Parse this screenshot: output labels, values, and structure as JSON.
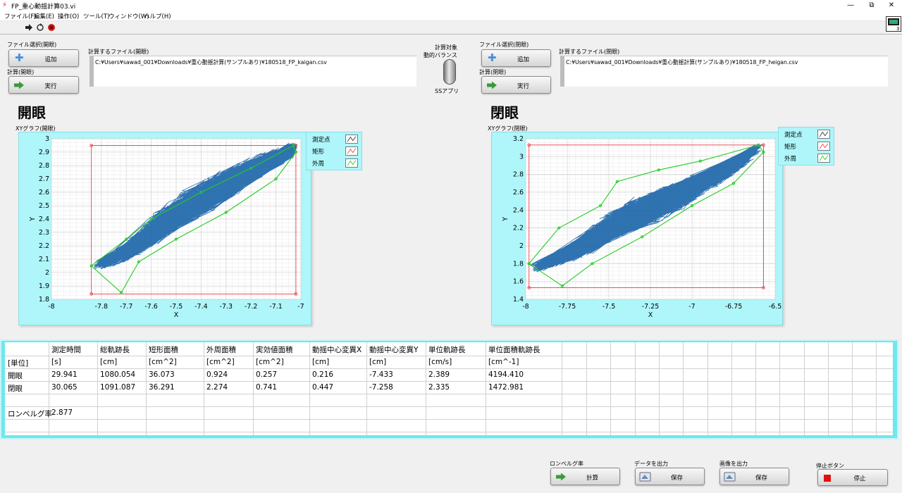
{
  "window": {
    "title": "FP_重心動揺計算03.vi",
    "controls": [
      "—",
      "⧉",
      "✕"
    ]
  },
  "menu": [
    "ファイル(F)",
    "編集(E)",
    "操作(O)",
    "ツール(T)",
    "ウィンドウ(W)",
    "ヘルプ(H)"
  ],
  "left_panel": {
    "file_select_label": "ファイル選択(開眼)",
    "add_button": "追加",
    "calc_label": "計算(開眼)",
    "run_button": "実行",
    "file_list_label": "計算するファイル(開眼)",
    "file_path": "C:¥Users¥sawad_001¥Downloads¥重心動揺計算(サンプルあり)¥180518_FP_kaigan.csv",
    "big_title": "開眼",
    "graph_label": "XYグラフ(開眼)"
  },
  "right_panel": {
    "file_select_label": "ファイル選択(閉眼)",
    "add_button": "追加",
    "calc_label": "計算(閉眼)",
    "run_button": "実行",
    "file_list_label": "計算するファイル(閉眼)",
    "file_path": "C:¥Users¥sawad_001¥Downloads¥重心動揺計算(サンプルあり)¥180518_FP_heigan.csv",
    "big_title": "閉眼",
    "graph_label": "XYグラフ(閉眼)"
  },
  "toggle": {
    "label_top": "計算対象",
    "label_top2": "動的バランス",
    "label_bottom": "SSアプリ"
  },
  "legend": [
    "測定点",
    "矩形",
    "外周"
  ],
  "colors": {
    "trace": "#1a64a8",
    "rect": "#e8404a",
    "hull": "#22cc22",
    "graph_bg": "#aef6fa",
    "table_frame": "#6fe7ee"
  },
  "chart_data": [
    {
      "type": "scatter",
      "title": "XYグラフ(開眼)",
      "xlabel": "X",
      "ylabel": "Y",
      "xlim": [
        -8,
        -7
      ],
      "ylim": [
        1.8,
        3
      ],
      "x_ticks": [
        "-8",
        "-7.8",
        "-7.7",
        "-7.6",
        "-7.5",
        "-7.4",
        "-7.3",
        "-7.2",
        "-7.1",
        "-7"
      ],
      "x_tick_values": [
        -8,
        -7.8,
        -7.7,
        -7.6,
        -7.5,
        -7.4,
        -7.3,
        -7.2,
        -7.1,
        -7
      ],
      "y_ticks": [
        "1.8",
        "1.9",
        "2",
        "2.1",
        "2.2",
        "2.3",
        "2.4",
        "2.5",
        "2.6",
        "2.7",
        "2.8",
        "2.9",
        "3"
      ],
      "y_tick_values": [
        1.8,
        1.9,
        2,
        2.1,
        2.2,
        2.3,
        2.4,
        2.5,
        2.6,
        2.7,
        2.8,
        2.9,
        3
      ],
      "rect": {
        "x": [
          -7.84,
          -7.02
        ],
        "y": [
          1.84,
          2.95
        ]
      },
      "series": [
        {
          "name": "測定点",
          "x": [
            -7.82,
            -7.72,
            -7.62,
            -7.55,
            -7.45,
            -7.35,
            -7.25,
            -7.15,
            -7.05,
            -7.03
          ],
          "y": [
            2.05,
            2.12,
            2.25,
            2.38,
            2.5,
            2.6,
            2.72,
            2.82,
            2.9,
            2.94
          ]
        },
        {
          "name": "外周",
          "x": [
            -7.84,
            -7.7,
            -7.6,
            -7.4,
            -7.2,
            -7.03,
            -7.02,
            -7.1,
            -7.3,
            -7.5,
            -7.65,
            -7.72,
            -7.84
          ],
          "y": [
            2.05,
            2.25,
            2.4,
            2.6,
            2.78,
            2.95,
            2.9,
            2.7,
            2.45,
            2.25,
            2.08,
            1.85,
            2.05
          ]
        }
      ]
    },
    {
      "type": "scatter",
      "title": "XYグラフ(閉眼)",
      "xlabel": "X",
      "ylabel": "Y",
      "xlim": [
        -8,
        -6.5
      ],
      "ylim": [
        1.4,
        3.2
      ],
      "x_ticks": [
        "-8",
        "-7.75",
        "-7.5",
        "-7.25",
        "-7",
        "-6.75",
        "-6.5"
      ],
      "x_tick_values": [
        -8,
        -7.75,
        -7.5,
        -7.25,
        -7,
        -6.75,
        -6.5
      ],
      "y_ticks": [
        "1.4",
        "1.6",
        "1.8",
        "2",
        "2.2",
        "2.4",
        "2.6",
        "2.8",
        "3",
        "3.2"
      ],
      "y_tick_values": [
        1.4,
        1.6,
        1.8,
        2,
        2.2,
        2.4,
        2.6,
        2.8,
        3,
        3.2
      ],
      "rect": {
        "x": [
          -7.98,
          -6.57
        ],
        "y": [
          1.53,
          3.13
        ]
      },
      "series": [
        {
          "name": "測定点",
          "x": [
            -7.95,
            -7.8,
            -7.65,
            -7.5,
            -7.35,
            -7.2,
            -7.05,
            -6.9,
            -6.75,
            -6.6
          ],
          "y": [
            1.75,
            1.85,
            2.0,
            2.2,
            2.35,
            2.45,
            2.6,
            2.75,
            2.9,
            3.1
          ]
        },
        {
          "name": "外周",
          "x": [
            -7.98,
            -7.8,
            -7.55,
            -7.45,
            -7.2,
            -6.95,
            -6.6,
            -6.57,
            -6.75,
            -7.0,
            -7.3,
            -7.6,
            -7.78,
            -7.98
          ],
          "y": [
            1.8,
            2.2,
            2.45,
            2.72,
            2.85,
            2.95,
            3.13,
            3.05,
            2.7,
            2.45,
            2.1,
            1.8,
            1.55,
            1.8
          ]
        }
      ]
    }
  ],
  "table": {
    "headers": [
      "",
      "測定時間",
      "総軌跡長",
      "短形面積",
      "外周面積",
      "実効値面積",
      "動揺中心変異X",
      "動揺中心変異Y",
      "単位軌跡長",
      "単位面積軌跡長"
    ],
    "rows": [
      [
        "[単位]",
        "[s]",
        "[cm]",
        "[cm^2]",
        "[cm^2]",
        "[cm^2]",
        "[cm]",
        "[cm]",
        "[cm/s]",
        "[cm^-1]"
      ],
      [
        "開眼",
        "29.941",
        "1080.054",
        "36.073",
        "0.924",
        "0.257",
        "0.216",
        "-7.433",
        "2.389",
        "4194.410"
      ],
      [
        "閉眼",
        "30.065",
        "1091.087",
        "36.291",
        "2.274",
        "0.741",
        "0.447",
        "-7.258",
        "2.335",
        "1472.981"
      ],
      [
        "",
        "",
        "",
        "",
        "",
        "",
        "",
        "",
        "",
        ""
      ],
      [
        "ロンベルグ率",
        "2.877",
        "",
        "",
        "",
        "",
        "",
        "",
        "",
        ""
      ]
    ]
  },
  "bottom": {
    "romberg_label": "ロンベルグ率",
    "romberg_button": "計算",
    "data_label": "データを出力",
    "data_button": "保存",
    "image_label": "画像を出力",
    "image_button": "保存",
    "stop_label": "停止ボタン",
    "stop_button": "停止"
  }
}
